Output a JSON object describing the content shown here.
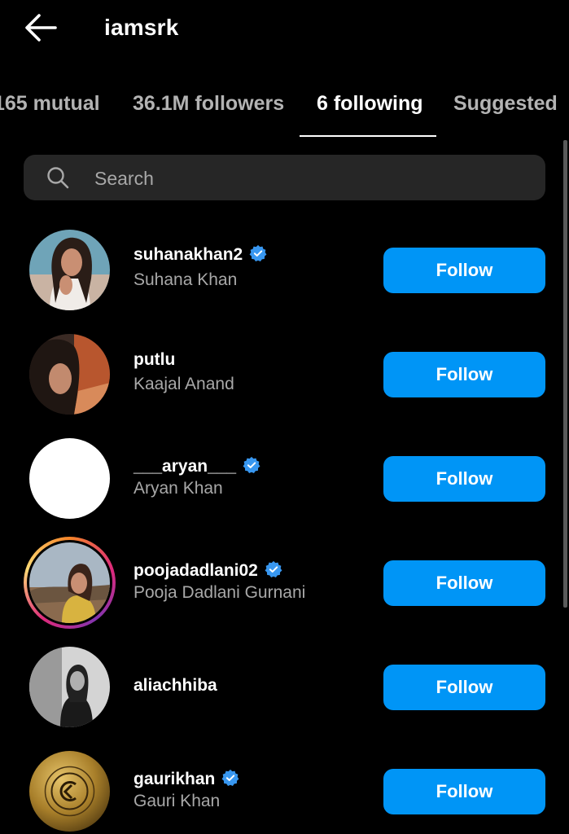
{
  "header": {
    "title": "iamsrk"
  },
  "tabs": [
    {
      "label": "165 mutual"
    },
    {
      "label": "36.1M followers"
    },
    {
      "label": "6 following"
    },
    {
      "label": "Suggested"
    }
  ],
  "search": {
    "placeholder": "Search"
  },
  "users": [
    {
      "username": "suhanakhan2",
      "full_name": "Suhana Khan",
      "verified": true,
      "button": "Follow"
    },
    {
      "username": "putlu",
      "full_name": "Kaajal Anand",
      "verified": false,
      "button": "Follow"
    },
    {
      "username": "___aryan___",
      "full_name": "Aryan Khan",
      "verified": true,
      "button": "Follow"
    },
    {
      "username": "poojadadlani02",
      "full_name": "Pooja Dadlani Gurnani",
      "verified": true,
      "button": "Follow"
    },
    {
      "username": "aliachhiba",
      "full_name": "",
      "verified": false,
      "button": "Follow"
    },
    {
      "username": "gaurikhan",
      "full_name": "Gauri Khan",
      "verified": true,
      "button": "Follow"
    }
  ],
  "colors": {
    "accent": "#0095f6",
    "verified": "#3897f0",
    "background": "#000000",
    "search_bg": "#262626"
  }
}
